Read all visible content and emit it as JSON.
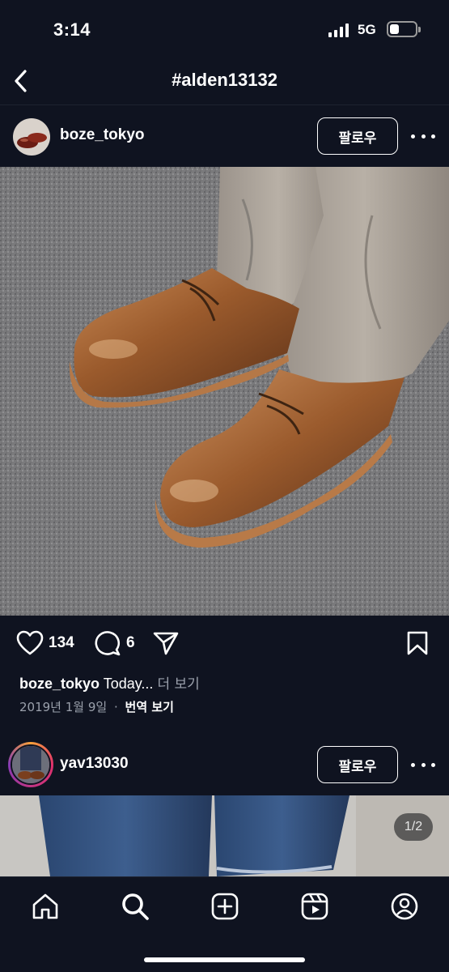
{
  "status_bar": {
    "time": "3:14",
    "network": "5G",
    "battery_level": 0.35
  },
  "nav": {
    "title": "#alden13132"
  },
  "posts": [
    {
      "username": "boze_tokyo",
      "follow_label": "팔로우",
      "likes": "134",
      "comments": "6",
      "caption_user": "boze_tokyo",
      "caption_text": "Today...",
      "more_label": "더 보기",
      "date": "2019년 1월 9일",
      "separator": "·",
      "translate_label": "번역 보기"
    },
    {
      "username": "yav13030",
      "follow_label": "팔로우",
      "page_indicator": "1/2"
    }
  ],
  "icons": {
    "back": "chevron-left-icon",
    "more": "ellipsis-icon",
    "like": "heart-icon",
    "comment": "comment-icon",
    "share": "send-icon",
    "save": "bookmark-icon",
    "tabs": [
      "home-icon",
      "search-icon",
      "create-icon",
      "reels-icon",
      "profile-icon"
    ]
  },
  "colors": {
    "background": "#0f1320",
    "muted_text": "#9aa0ab"
  }
}
